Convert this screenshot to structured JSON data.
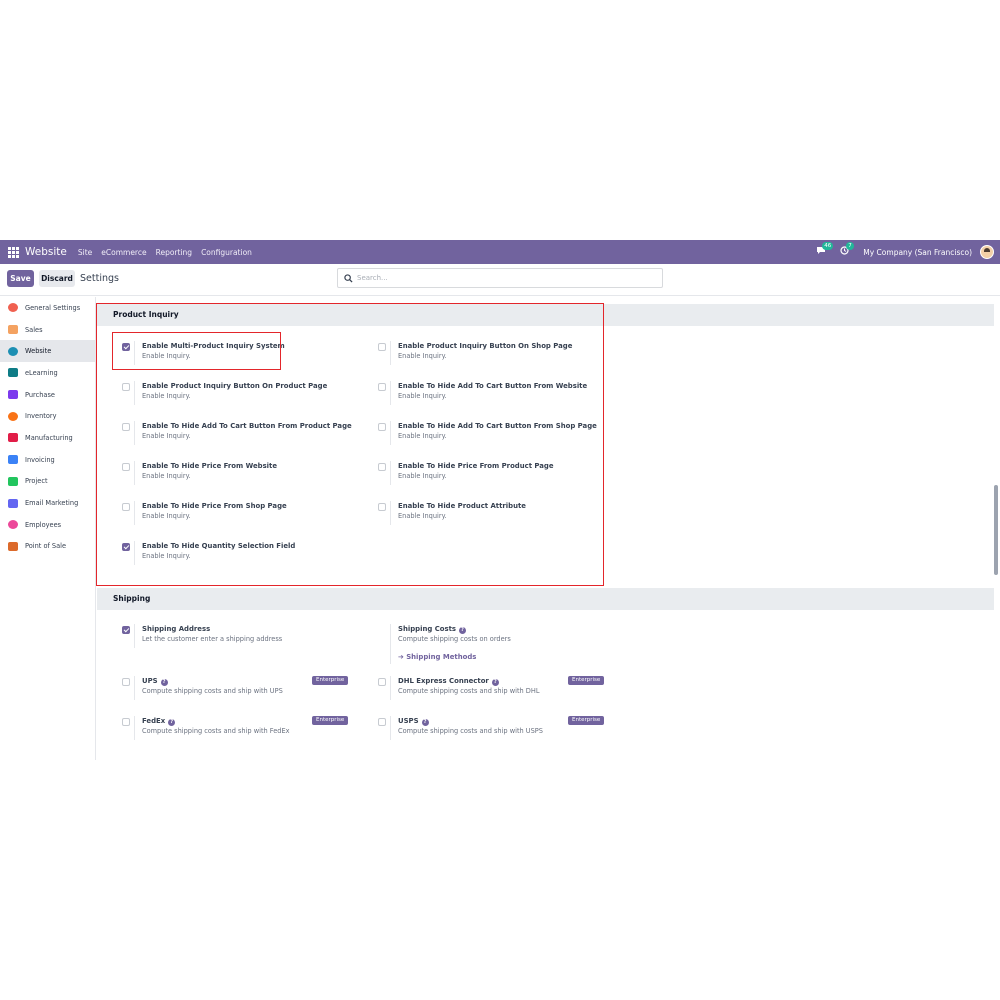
{
  "navbar": {
    "app_title": "Website",
    "menus": [
      "Site",
      "eCommerce",
      "Reporting",
      "Configuration"
    ],
    "messages_count": "46",
    "activities_count": "7",
    "company": "My Company (San Francisco)"
  },
  "control": {
    "save_label": "Save",
    "discard_label": "Discard",
    "title": "Settings",
    "search_placeholder": "Search..."
  },
  "sidebar": {
    "items": [
      {
        "label": "General Settings",
        "icon": "general-settings-icon",
        "color": "#f06050"
      },
      {
        "label": "Sales",
        "icon": "sales-icon",
        "color": "#f4a261"
      },
      {
        "label": "Website",
        "icon": "website-icon",
        "color": "#1c8fb3"
      },
      {
        "label": "eLearning",
        "icon": "elearning-icon",
        "color": "#0e7c86"
      },
      {
        "label": "Purchase",
        "icon": "purchase-icon",
        "color": "#7c3aed"
      },
      {
        "label": "Inventory",
        "icon": "inventory-icon",
        "color": "#f97316"
      },
      {
        "label": "Manufacturing",
        "icon": "manufacturing-icon",
        "color": "#e11d48"
      },
      {
        "label": "Invoicing",
        "icon": "invoicing-icon",
        "color": "#3b82f6"
      },
      {
        "label": "Project",
        "icon": "project-icon",
        "color": "#22c55e"
      },
      {
        "label": "Email Marketing",
        "icon": "email-marketing-icon",
        "color": "#6366f1"
      },
      {
        "label": "Employees",
        "icon": "employees-icon",
        "color": "#ec4899"
      },
      {
        "label": "Point of Sale",
        "icon": "point-of-sale-icon",
        "color": "#dc6a2b"
      }
    ],
    "active_index": 2
  },
  "product_inquiry": {
    "title": "Product Inquiry",
    "settings": [
      {
        "title": "Enable Multi-Product Inquiry System",
        "desc": "Enable Inquiry.",
        "checked": true
      },
      {
        "title": "Enable Product Inquiry Button On Shop Page",
        "desc": "Enable Inquiry.",
        "checked": false
      },
      {
        "title": "Enable Product Inquiry Button On Product Page",
        "desc": "Enable Inquiry.",
        "checked": false
      },
      {
        "title": "Enable To Hide Add To Cart Button From Website",
        "desc": "Enable Inquiry.",
        "checked": false
      },
      {
        "title": "Enable To Hide Add To Cart Button From Product Page",
        "desc": "Enable Inquiry.",
        "checked": false
      },
      {
        "title": "Enable To Hide Add To Cart Button From Shop Page",
        "desc": "Enable Inquiry.",
        "checked": false
      },
      {
        "title": "Enable To Hide Price From Website",
        "desc": "Enable Inquiry.",
        "checked": false
      },
      {
        "title": "Enable To Hide Price From Product Page",
        "desc": "Enable Inquiry.",
        "checked": false
      },
      {
        "title": "Enable To Hide Price From Shop Page",
        "desc": "Enable Inquiry.",
        "checked": false
      },
      {
        "title": "Enable To Hide Product Attribute",
        "desc": "Enable Inquiry.",
        "checked": false
      },
      {
        "title": "Enable To Hide Quantity Selection Field",
        "desc": "Enable Inquiry.",
        "checked": true
      }
    ]
  },
  "shipping": {
    "title": "Shipping",
    "shipping_address": {
      "title": "Shipping Address",
      "desc": "Let the customer enter a shipping address",
      "checked": true
    },
    "shipping_costs": {
      "title": "Shipping Costs",
      "desc": "Compute shipping costs on orders",
      "link": "Shipping Methods"
    },
    "enterprise_label": "Enterprise",
    "ups": {
      "title": "UPS",
      "desc": "Compute shipping costs and ship with UPS",
      "checked": false
    },
    "dhl": {
      "title": "DHL Express Connector",
      "desc": "Compute shipping costs and ship with DHL",
      "checked": false
    },
    "fedex": {
      "title": "FedEx",
      "desc": "Compute shipping costs and ship with FedEx",
      "checked": false
    },
    "usps": {
      "title": "USPS",
      "desc": "Compute shipping costs and ship with USPS",
      "checked": false
    }
  },
  "colors": {
    "brand": "#71639e",
    "highlight": "#e3262b"
  }
}
